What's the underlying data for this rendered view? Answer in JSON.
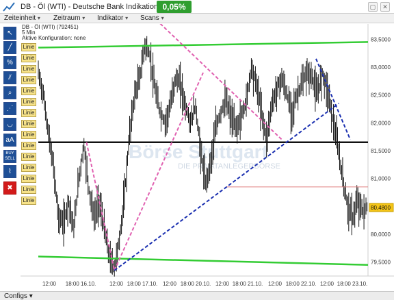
{
  "window": {
    "title": "DB - Öl (WTI) - Deutsche Bank Indikation",
    "change_badge": "0,05%",
    "badge_color": "#2f9e2f",
    "buttons": [
      "▢",
      "✕"
    ]
  },
  "menu": {
    "items": [
      {
        "label": "Zeiteinheit",
        "arrow": "▾"
      },
      {
        "label": "Zeitraum",
        "arrow": "▾"
      },
      {
        "label": "Indikator",
        "arrow": "▾"
      },
      {
        "label": "Scans",
        "arrow": "▾"
      }
    ]
  },
  "info": {
    "line1": "DB - Öl (WTI) (792451)",
    "line2": "5 Min",
    "line3": "Aktive Konfiguration: none"
  },
  "toolbar": {
    "tools": [
      {
        "name": "pointer-tool",
        "glyph": "↖"
      },
      {
        "name": "line-tool",
        "glyph": "╱"
      },
      {
        "name": "percent-tool",
        "glyph": "%"
      },
      {
        "name": "channel-tool",
        "glyph": "⫽"
      },
      {
        "name": "search-tool",
        "glyph": "⌕"
      },
      {
        "name": "fibonacci-tool",
        "glyph": "⋰"
      },
      {
        "name": "arc-tool",
        "glyph": "◡"
      },
      {
        "name": "text-tool",
        "glyph": "aA"
      },
      {
        "name": "buy-sell-tool",
        "glyph": "BUY SELL"
      },
      {
        "name": "measure-tool",
        "glyph": "⌇"
      },
      {
        "name": "delete-tool",
        "glyph": "✖"
      }
    ],
    "linie_label": "Linie",
    "linie_count": 15
  },
  "watermark": {
    "line1": "Börse Stuttgart",
    "line2": "DIE PRIVATANLEGERBÖRSE"
  },
  "chart_data": {
    "type": "candlestick",
    "y_axis": {
      "ticks": [
        "83,5000",
        "83,0000",
        "82,5000",
        "82,0000",
        "81,5000",
        "81,0000",
        "80,5000",
        "80,0000",
        "79,5000"
      ],
      "ylim": [
        79.25,
        83.75
      ]
    },
    "x_axis": {
      "ticks": [
        "12:00",
        "18:00 16.10.",
        "12:00",
        "18:00 17.10.",
        "12:00",
        "18:00 20.10.",
        "12:00",
        "18:00 21.10.",
        "12:00",
        "18:00 22.10.",
        "12:00",
        "18:00 23.10."
      ]
    },
    "current_price": "80,4800",
    "current_price_color": "#f5c518",
    "series_approx_path": [
      [
        0,
        82.9
      ],
      [
        4,
        82.5
      ],
      [
        8,
        81.8
      ],
      [
        12,
        81.2
      ],
      [
        16,
        80.3
      ],
      [
        20,
        80.2
      ],
      [
        24,
        80.6
      ],
      [
        28,
        80.1
      ],
      [
        32,
        81.0
      ],
      [
        36,
        81.6
      ],
      [
        40,
        80.8
      ],
      [
        44,
        80.3
      ],
      [
        48,
        80.6
      ],
      [
        52,
        80.1
      ],
      [
        56,
        79.6
      ],
      [
        60,
        79.4
      ],
      [
        64,
        79.9
      ],
      [
        68,
        80.7
      ],
      [
        72,
        81.8
      ],
      [
        76,
        82.5
      ],
      [
        80,
        82.8
      ],
      [
        84,
        83.4
      ],
      [
        88,
        83.2
      ],
      [
        92,
        82.6
      ],
      [
        96,
        82.2
      ],
      [
        100,
        82.0
      ],
      [
        104,
        82.3
      ],
      [
        108,
        82.8
      ],
      [
        112,
        82.7
      ],
      [
        116,
        82.3
      ],
      [
        120,
        82.0
      ],
      [
        124,
        82.3
      ],
      [
        128,
        81.5
      ],
      [
        132,
        80.9
      ],
      [
        136,
        81.3
      ],
      [
        140,
        81.9
      ],
      [
        144,
        82.2
      ],
      [
        148,
        82.4
      ],
      [
        152,
        82.1
      ],
      [
        156,
        81.9
      ],
      [
        160,
        82.1
      ],
      [
        164,
        82.4
      ],
      [
        168,
        83.0
      ],
      [
        172,
        82.7
      ],
      [
        176,
        82.2
      ],
      [
        180,
        81.7
      ],
      [
        184,
        82.3
      ],
      [
        188,
        82.6
      ],
      [
        192,
        82.8
      ],
      [
        196,
        82.5
      ],
      [
        200,
        82.2
      ],
      [
        204,
        82.5
      ],
      [
        208,
        82.7
      ],
      [
        212,
        82.9
      ],
      [
        216,
        82.8
      ],
      [
        220,
        82.5
      ],
      [
        224,
        82.9
      ],
      [
        228,
        82.6
      ],
      [
        232,
        82.1
      ],
      [
        236,
        81.6
      ],
      [
        240,
        81.0
      ],
      [
        244,
        80.5
      ],
      [
        248,
        80.3
      ],
      [
        252,
        80.6
      ],
      [
        256,
        80.4
      ],
      [
        260,
        80.5
      ]
    ],
    "drawings": [
      {
        "kind": "horizontal",
        "color": "#33cc33",
        "from": [
          0,
          83.35
        ],
        "to": [
          260,
          83.45
        ]
      },
      {
        "kind": "horizontal",
        "color": "#33cc33",
        "from": [
          0,
          79.6
        ],
        "to": [
          260,
          79.45
        ]
      },
      {
        "kind": "horizontal",
        "color": "#111111",
        "from": [
          0,
          81.65
        ],
        "to": [
          260,
          81.65
        ]
      },
      {
        "kind": "horizontal",
        "color": "#e08080",
        "from": [
          148,
          80.85
        ],
        "to": [
          260,
          80.85
        ]
      },
      {
        "kind": "dashed",
        "color": "#e060b0",
        "from": [
          38,
          81.65
        ],
        "to": [
          60,
          79.35
        ]
      },
      {
        "kind": "dashed",
        "color": "#e060b0",
        "from": [
          60,
          79.35
        ],
        "to": [
          130,
          82.9
        ]
      },
      {
        "kind": "dashed",
        "color": "#e060b0",
        "from": [
          93,
          83.85
        ],
        "to": [
          192,
          81.7
        ]
      },
      {
        "kind": "dashed",
        "color": "#1a2fb0",
        "from": [
          60,
          79.35
        ],
        "to": [
          237,
          82.35
        ]
      },
      {
        "kind": "dashed",
        "color": "#1a2fb0",
        "from": [
          219,
          83.15
        ],
        "to": [
          246,
          81.7
        ]
      }
    ]
  },
  "footer": {
    "config_label": "Configs",
    "config_arrow": "▾"
  }
}
